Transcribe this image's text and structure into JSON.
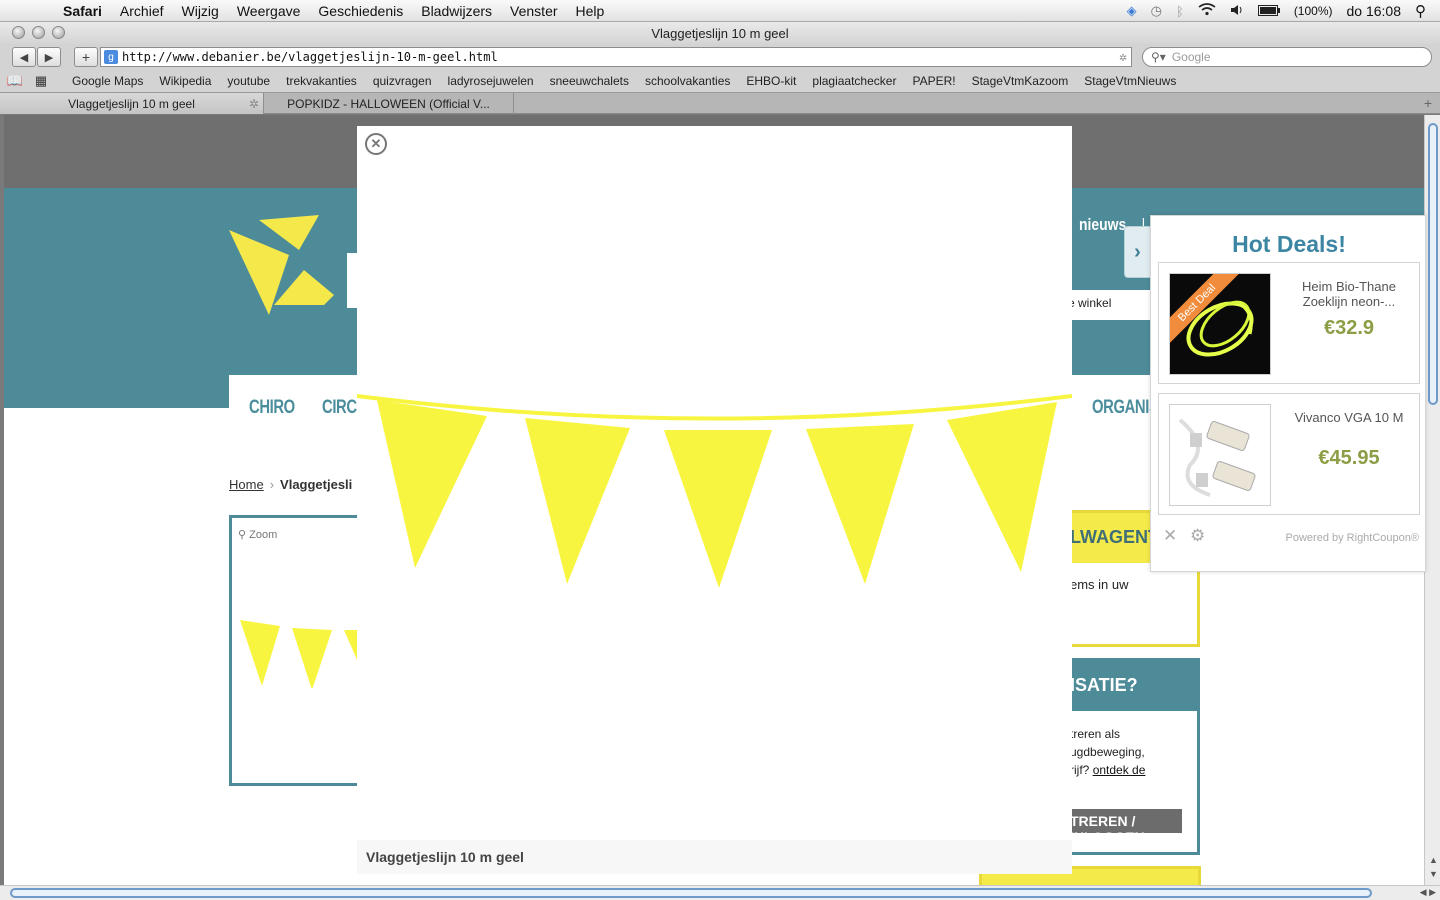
{
  "menubar": {
    "app": "Safari",
    "items": [
      "Archief",
      "Wijzig",
      "Weergave",
      "Geschiedenis",
      "Bladwijzers",
      "Venster",
      "Help"
    ],
    "battery": "(100%)",
    "clock": "do 16:08"
  },
  "window": {
    "title": "Vlaggetjeslijn 10 m geel"
  },
  "toolbar": {
    "url": "http://www.debanier.be/vlaggetjeslijn-10-m-geel.html",
    "search_placeholder": "Google"
  },
  "bookmarks": [
    "Google Maps",
    "Wikipedia",
    "youtube",
    "trekvakanties",
    "quizvragen",
    "ladyrosejuwelen",
    "sneeuwchalets",
    "schoolvakanties",
    "EHBO-kit",
    "plagiaatchecker",
    "PAPER!",
    "StageVtmKazoom",
    "StageVtmNieuws"
  ],
  "tabs": [
    {
      "label": "Vlaggetjeslijn 10 m geel",
      "active": true
    },
    {
      "label": "POPKIDZ - HALLOWEEN (Official V...",
      "active": false
    }
  ],
  "page": {
    "nav": [
      "CHIRO",
      "CIRCU",
      "ORGANIS"
    ],
    "top_nav": "nieuws",
    "top_nav_sep": "|",
    "winkel": "e winkel",
    "breadcrumb": {
      "home": "Home",
      "current": "Vlaggetjesli"
    },
    "zoom_label": "Zoom",
    "cart": {
      "heading": "LWAGENTJE",
      "body": "ems in uw"
    },
    "org": {
      "heading": "ISATIE?",
      "line1": "treren als",
      "line2": "ugdbeweging,",
      "line3": "rijf?",
      "link": "ontdek de",
      "button": "TREREN / INLOGGEN"
    }
  },
  "lightbox": {
    "caption": "Vlaggetjeslijn 10 m geel",
    "flag_color": "#f8f540"
  },
  "deals": {
    "title": "Hot Deals!",
    "items": [
      {
        "name": "Heim Bio-Thane Zoeklijn neon-...",
        "price": "€32.9",
        "ribbon": "Best Deal"
      },
      {
        "name": "Vivanco VGA 10 M",
        "price": "€45.95"
      }
    ],
    "powered": "Powered by RightCoupon®"
  },
  "colors": {
    "teal": "#4e8b99",
    "yellow": "#f4ea4a",
    "deals_title": "#3d86a3",
    "price_green": "#8c9e45"
  }
}
